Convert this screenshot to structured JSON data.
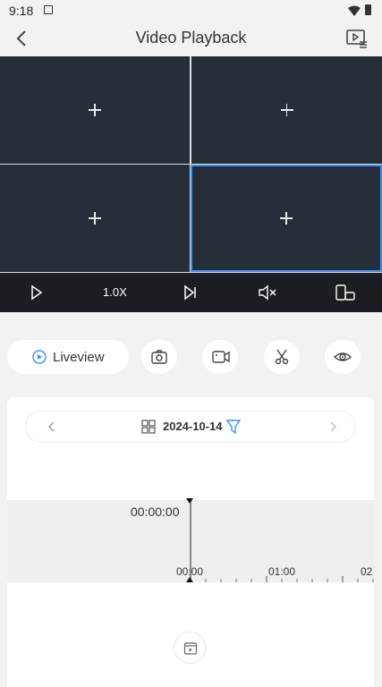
{
  "status_bar": {
    "time": "9:18"
  },
  "header": {
    "title": "Video Playback"
  },
  "toolbar": {
    "speed": "1.0X"
  },
  "actions": {
    "liveview_label": "Liveview"
  },
  "timeline": {
    "date": "2024-10-14",
    "current_time": "00:00:00",
    "tick_labels": [
      "00:00",
      "01:00",
      "02"
    ]
  },
  "colors": {
    "accent": "#3f8ff7",
    "player_bg": "#262f39",
    "toolbar_bg": "#1b1d20"
  }
}
